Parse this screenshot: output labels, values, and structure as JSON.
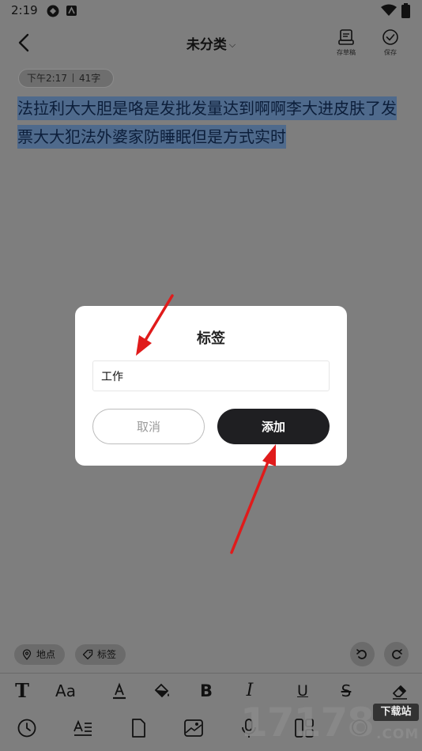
{
  "status_bar": {
    "time": "2:19"
  },
  "header": {
    "title": "未分类",
    "draft_label": "存草稿",
    "save_label": "保存"
  },
  "note": {
    "time": "下午2:17",
    "word_count": "41字",
    "body": "法拉利大大胆是咯是发批发量达到啊啊李大进皮肤了发票大大犯法外婆家防睡眠但是方式实时"
  },
  "dialog": {
    "title": "标签",
    "input_value": "工作",
    "cancel_label": "取消",
    "add_label": "添加"
  },
  "chips": {
    "location": "地点",
    "tag": "标签"
  },
  "format_toolbar": {
    "text_size": "Aa",
    "bold": "B",
    "italic": "I",
    "underline": "U",
    "strike": "S"
  },
  "watermark": {
    "digits": "17178",
    "site_label": "下载站",
    "domain": ".COM"
  },
  "colors": {
    "overlay": "#7e7e7e",
    "selection": "#4f6a8c",
    "add_button": "#1f1f22",
    "arrow": "#e01b1b"
  }
}
